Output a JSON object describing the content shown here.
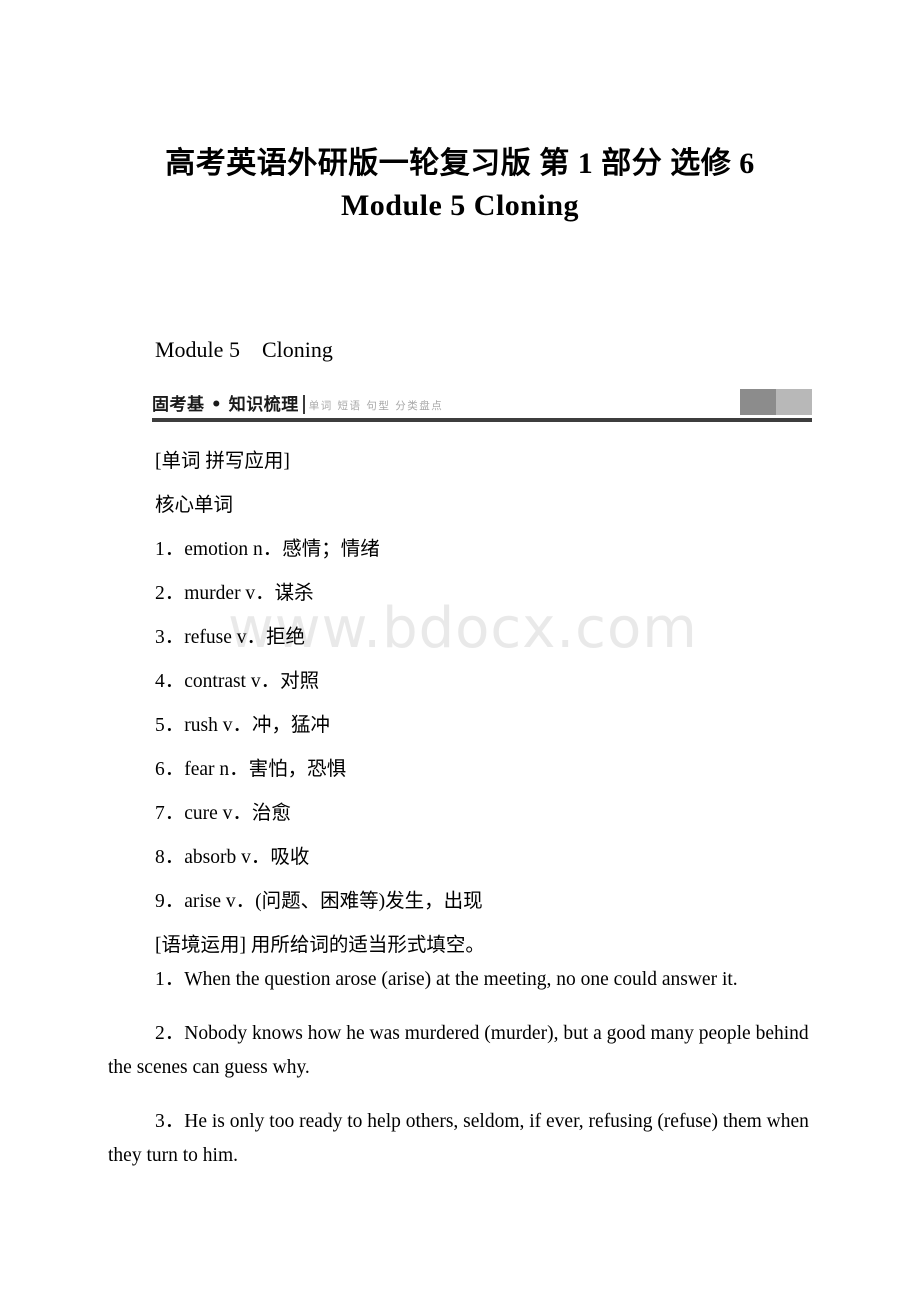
{
  "document": {
    "title_line1": "高考英语外研版一轮复习版 第 1 部分 选修 6",
    "title_line2": "Module 5 Cloning",
    "module_heading": "Module 5    Cloning",
    "watermark": "www.bdocx.com"
  },
  "banner": {
    "title": "固考基 • 知识梳理",
    "subtitle": "单词  短语  句型  分类盘点",
    "block_dark_color": "#8c8c8c",
    "block_light_color": "#b8b8b8",
    "rule_color": "#3d3d3d"
  },
  "vocab_section": {
    "label": "[单词    拼写应用]",
    "subheading": "核心单词",
    "entries": [
      "1．emotion n．感情；情绪",
      "2．murder v．谋杀",
      "3．refuse v．拒绝",
      "4．contrast v．对照",
      "5．rush v．冲，猛冲",
      "6．fear n．害怕，恐惧",
      "7．cure v．治愈",
      "8．absorb v．吸收",
      "9．arise  v．(问题、困难等)发生，出现"
    ]
  },
  "exercise_section": {
    "label": "[语境运用]    用所给词的适当形式填空。",
    "items": [
      "1．When the question arose (arise) at the meeting, no one could answer it.",
      "2．Nobody knows how he was murdered (murder), but a good many people behind the scenes can guess why.",
      "3．He is only too ready to help others, seldom, if ever, refusing (refuse) them when they turn to him."
    ]
  }
}
